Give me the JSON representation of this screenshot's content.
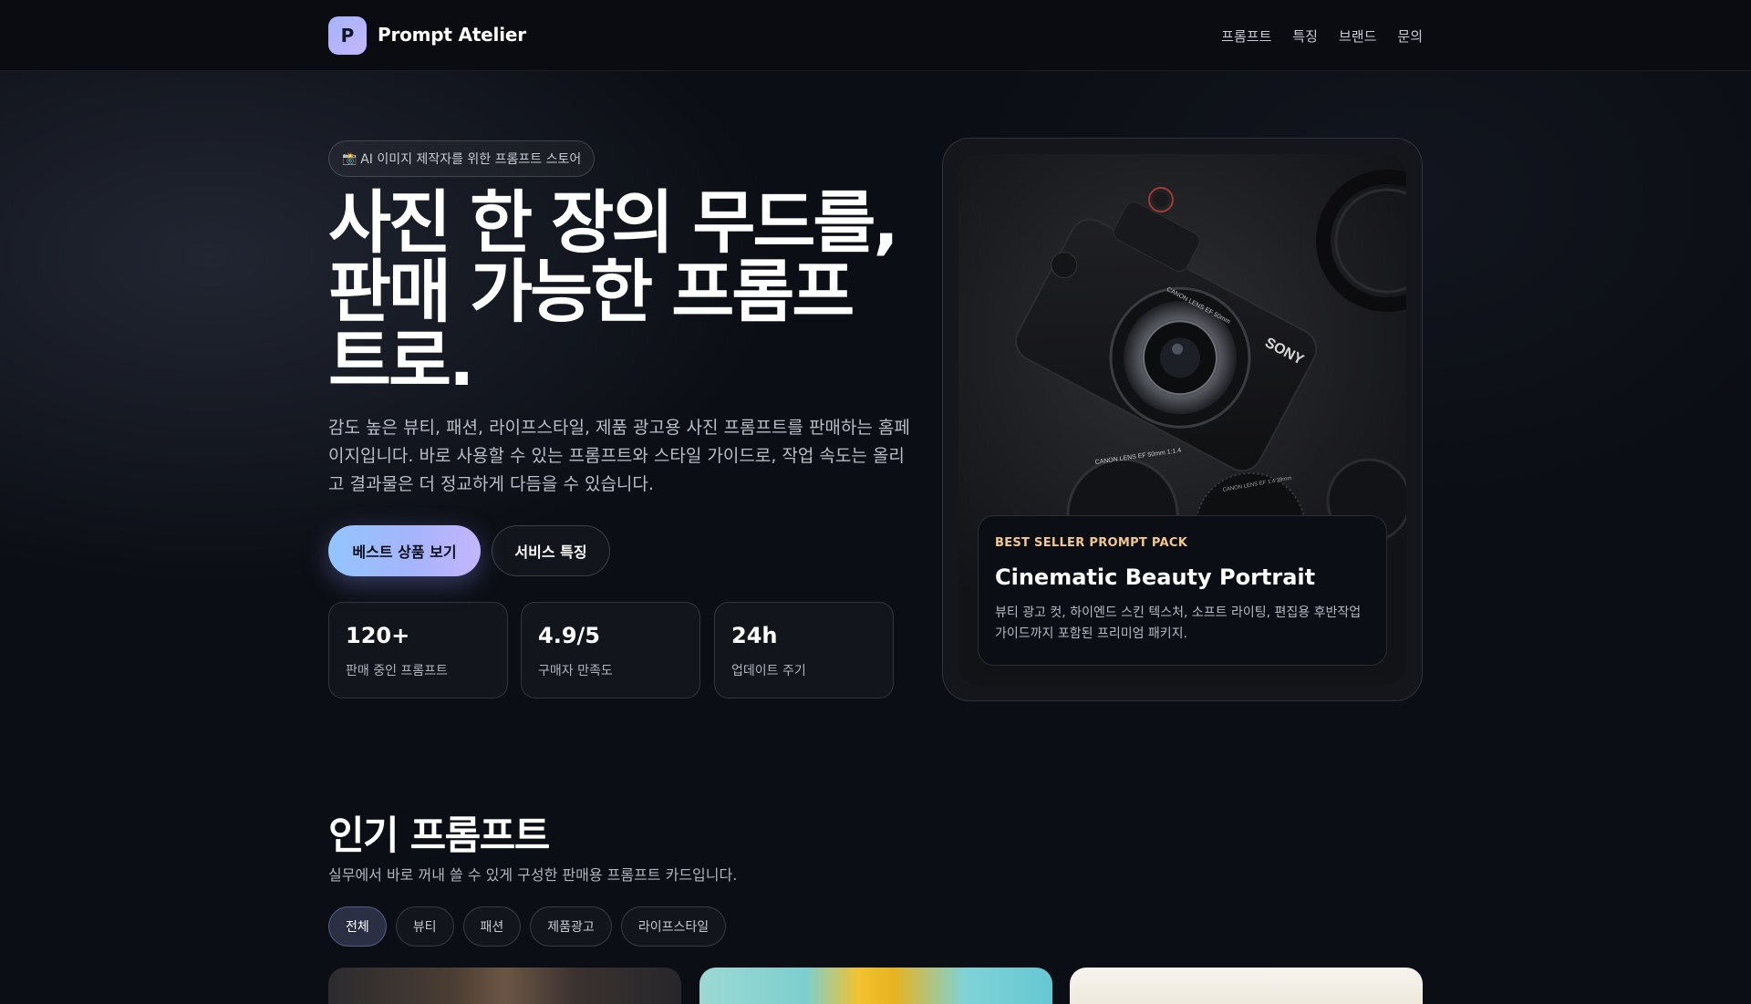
{
  "header": {
    "logo_letter": "P",
    "brand": "Prompt Atelier",
    "nav": [
      "프롬프트",
      "특징",
      "브랜드",
      "문의"
    ]
  },
  "hero": {
    "badge_icon": "camera-icon",
    "badge_text": "AI 이미지 제작자를 위한 프롬프트 스토어",
    "headline_lines": [
      "사진 한 장의 무드를,",
      "판매 가능한 프롬프",
      "트로."
    ],
    "lead": "감도 높은 뷰티, 패션, 라이프스타일, 제품 광고용 사진 프롬프트를 판매하는 홈페이지입니다. 바로 사용할 수 있는 프롬프트와 스타일 가이드로, 작업 속도는 올리고 결과물은 더 정교하게 다듬을 수 있습니다.",
    "primary_cta": "베스트 상품 보기",
    "secondary_cta": "서비스 특징",
    "stats": [
      {
        "value": "120+",
        "label": "판매 중인 프롬프트"
      },
      {
        "value": "4.9/5",
        "label": "구매자 만족도"
      },
      {
        "value": "24h",
        "label": "업데이트 주기"
      }
    ]
  },
  "featured": {
    "kicker": "BEST SELLER PROMPT PACK",
    "title": "Cinematic Beauty Portrait",
    "description": "뷰티 광고 컷, 하이엔드 스킨 텍스처, 소프트 라이팅, 편집용 후반작업 가이드까지 포함된 프리미엄 패키지.",
    "image_text": {
      "brand": "SONY",
      "lens": "CANON LENS EF 50mm",
      "lens2": "CANON LENS EF 50mm 1:1.4",
      "lens3": "CANON LENS EF 1:4 28mm"
    }
  },
  "popular": {
    "title": "인기 프롬프트",
    "subtitle": "실무에서 바로 꺼내 쓸 수 있게 구성한 판매용 프롬프트 카드입니다.",
    "filters": [
      "전체",
      "뷰티",
      "패션",
      "제품광고",
      "라이프스타일"
    ],
    "active_filter": "전체"
  },
  "colors": {
    "background": "#0b0e14",
    "accent_gradient_start": "#93c5fd",
    "accent_gradient_end": "#c4b5fd",
    "kicker": "#f3c98b"
  }
}
